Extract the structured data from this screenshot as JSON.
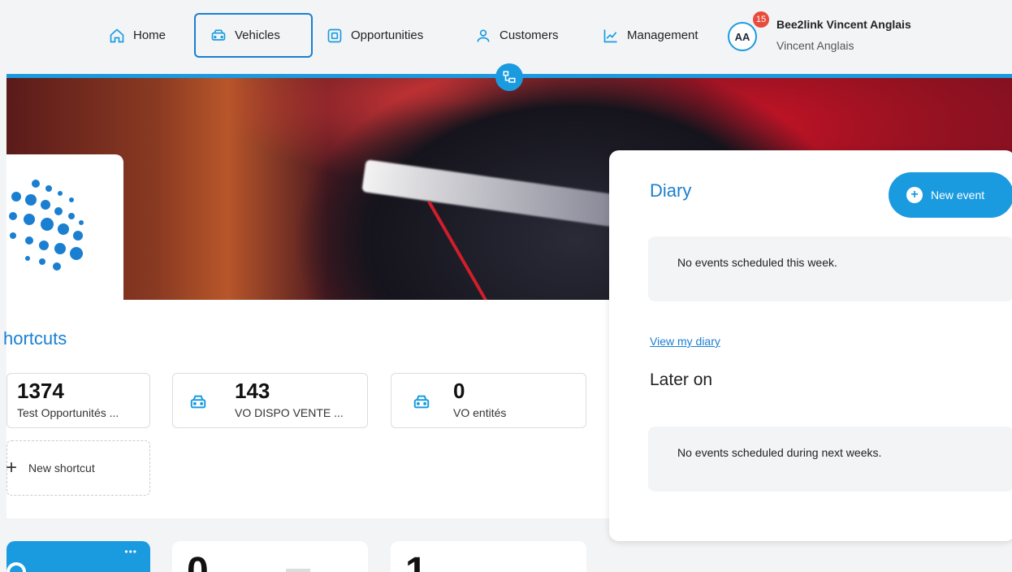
{
  "nav": {
    "home": "Home",
    "vehicles": "Vehicles",
    "opportunities": "Opportunities",
    "customers": "Customers",
    "management": "Management"
  },
  "user": {
    "initials": "AA",
    "notifications": "15",
    "name": "Bee2link Vincent Anglais",
    "subtitle": "Vincent Anglais"
  },
  "shortcuts": {
    "title": "hortcuts",
    "items": [
      {
        "count": "1374",
        "label": "Test Opportunités ..."
      },
      {
        "count": "143",
        "label": "VO DISPO VENTE ..."
      },
      {
        "count": "0",
        "label": "VO entités"
      }
    ],
    "new_label": "New shortcut"
  },
  "diary": {
    "title": "Diary",
    "new_event": "New event",
    "this_week_empty": "No events scheduled this week.",
    "view_link": "View my diary",
    "later_title": "Later on",
    "later_empty": "No events scheduled during next weeks."
  },
  "bottom_cards": {
    "card2_value": "0",
    "card3_value": "1",
    "menu_dots": "•••"
  },
  "colors": {
    "accent": "#1a9be0",
    "link": "#1a7fd1",
    "badge": "#e74c3c"
  }
}
